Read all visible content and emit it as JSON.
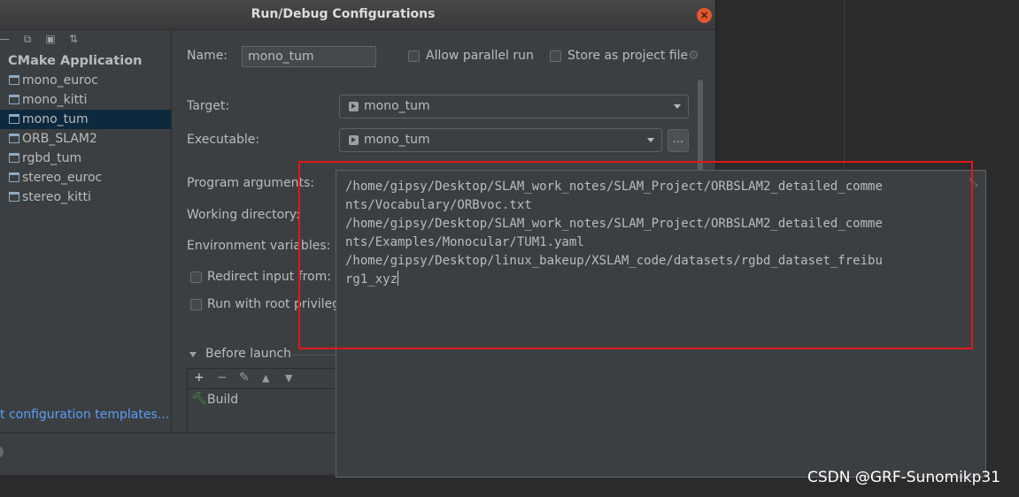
{
  "window": {
    "title": "Run/Debug Configurations",
    "close_icon": "close-icon"
  },
  "sidebar": {
    "toolbar_icons": [
      "remove-icon",
      "copy-icon",
      "folder-add-icon",
      "sort-icon"
    ],
    "root": "CMake Application",
    "items": [
      {
        "label": "mono_euroc"
      },
      {
        "label": "mono_kitti"
      },
      {
        "label": "mono_tum",
        "selected": true
      },
      {
        "label": "ORB_SLAM2"
      },
      {
        "label": "rgbd_tum"
      },
      {
        "label": "stereo_euroc"
      },
      {
        "label": "stereo_kitti"
      }
    ],
    "templates_link": "t configuration templates..."
  },
  "form": {
    "name_label": "Name:",
    "name_value": "mono_tum",
    "allow_parallel_label": "Allow parallel run",
    "store_project_label": "Store as project file",
    "target_label": "Target:",
    "target_value": "mono_tum",
    "executable_label": "Executable:",
    "executable_value": "mono_tum",
    "browse_label": "...",
    "program_args_label": "Program arguments:",
    "working_dir_label": "Working directory:",
    "env_vars_label": "Environment variables:",
    "redirect_input_label": "Redirect input from:",
    "run_root_label": "Run with root privilege",
    "before_launch_label": "Before launch",
    "before_launch_toolbar": [
      "+",
      "−",
      "✎",
      "▲",
      "▼"
    ],
    "build_label": "Build"
  },
  "popup": {
    "lines": [
      "/home/gipsy/Desktop/SLAM_work_notes/SLAM_Project/ORBSLAM2_detailed_comme",
      "nts/Vocabulary/ORBvoc.txt",
      "/home/gipsy/Desktop/SLAM_work_notes/SLAM_Project/ORBSLAM2_detailed_comme",
      "nts/Examples/Monocular/TUM1.yaml",
      "/home/gipsy/Desktop/linux_bakeup/XSLAM_code/datasets/rgbd_dataset_freibu",
      "rg1_xyz"
    ]
  },
  "watermark": "CSDN @GRF-Sunomikp31",
  "colors": {
    "selection": "#0d293e",
    "link": "#589df6",
    "highlight": "#e01818",
    "close": "#e4572e"
  }
}
